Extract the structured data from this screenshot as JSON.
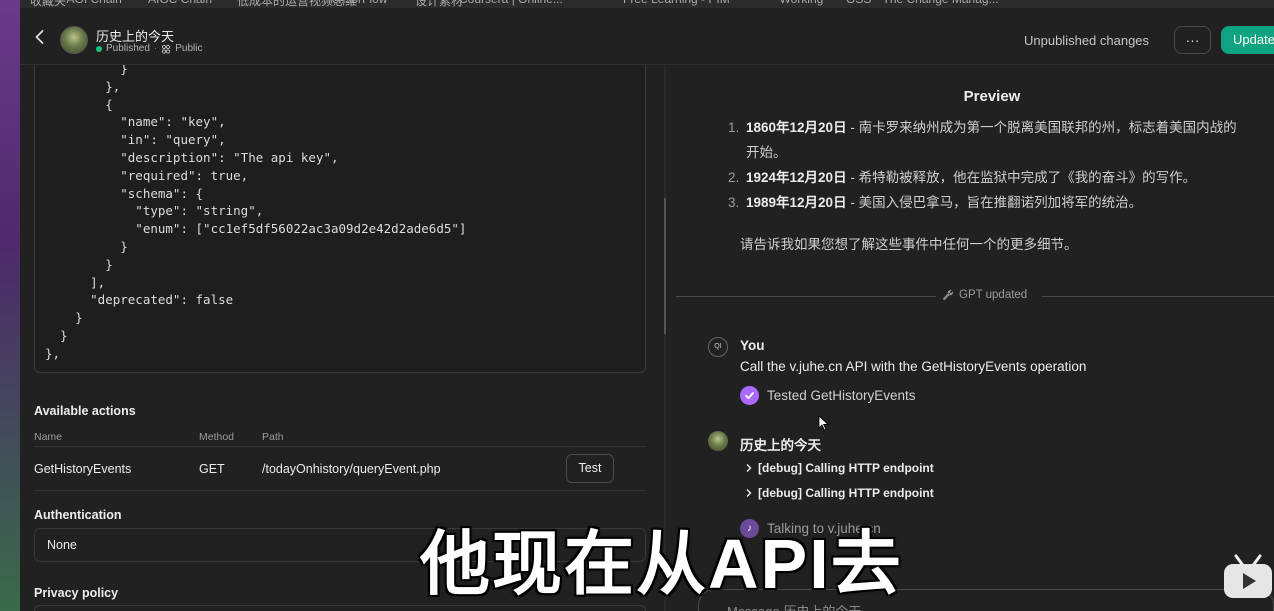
{
  "bookmarks": [
    "收藏夹",
    "AGI Chain",
    "AIGC Chain",
    "低成本的运营视频思维",
    "TensorFlow",
    "设计素材",
    "Coursera | Online...",
    "Free Learning - PIM",
    "Working",
    "OSS",
    "The Change Manag..."
  ],
  "header": {
    "title": "历史上的今天",
    "status": "Published",
    "visibility": "Public",
    "unpublished": "Unpublished changes",
    "more": "···",
    "update": "Update"
  },
  "schema": {
    "code": "          }\n        },\n        {\n          \"name\": \"key\",\n          \"in\": \"query\",\n          \"description\": \"The api key\",\n          \"required\": true,\n          \"schema\": {\n            \"type\": \"string\",\n            \"enum\": [\"cc1ef5df56022ac3a09d2e42d2ade6d5\"]\n          }\n        }\n      ],\n      \"deprecated\": false\n    }\n  }\n},"
  },
  "actions": {
    "title": "Available actions",
    "columns": [
      "Name",
      "Method",
      "Path"
    ],
    "rows": [
      {
        "name": "GetHistoryEvents",
        "method": "GET",
        "path": "/todayOnhistory/queryEvent.php",
        "test": "Test"
      }
    ]
  },
  "auth": {
    "title": "Authentication",
    "value": "None"
  },
  "privacy": {
    "title": "Privacy policy"
  },
  "preview": {
    "title": "Preview",
    "events": [
      {
        "num": "1.",
        "date": "1860年12月20日",
        "text": " - 南卡罗来纳州成为第一个脱离美国联邦的州，标志着美国内战的",
        "text2": "开始。"
      },
      {
        "num": "2.",
        "date": "1924年12月20日",
        "text": " - 希特勒被释放，他在监狱中完成了《我的奋斗》的写作。"
      },
      {
        "num": "3.",
        "date": "1989年12月20日",
        "text": " - 美国入侵巴拿马，旨在推翻诺列加将军的统治。"
      }
    ],
    "ask": "请告诉我如果您想了解这些事件中任何一个的更多细节。",
    "gpt_updated": "GPT updated",
    "user_initials": "QI",
    "you": "You",
    "user_msg": "Call the v.juhe.cn API with the GetHistoryEvents operation",
    "tested": "Tested GetHistoryEvents",
    "gpt_name": "历史上的今天",
    "debug": [
      "[debug] Calling HTTP endpoint",
      "[debug] Calling HTTP endpoint"
    ],
    "talking": "Talking to v.juhe.cn",
    "message_placeholder": "Message 历史上的今天..."
  },
  "subtitle": "他现在从API去"
}
